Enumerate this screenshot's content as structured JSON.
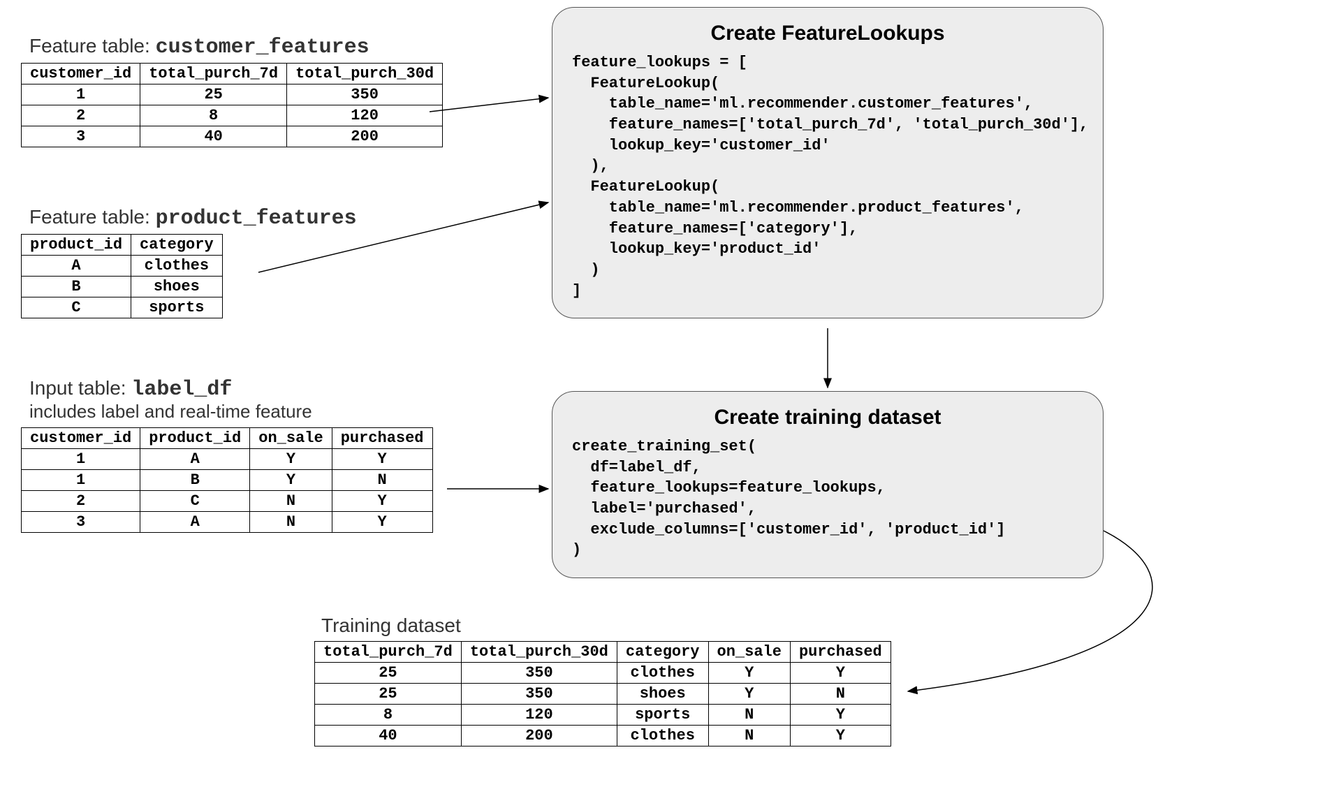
{
  "customer_features": {
    "caption_prefix": "Feature table: ",
    "caption_mono": "customer_features",
    "headers": [
      "customer_id",
      "total_purch_7d",
      "total_purch_30d"
    ],
    "rows": [
      [
        "1",
        "25",
        "350"
      ],
      [
        "2",
        "8",
        "120"
      ],
      [
        "3",
        "40",
        "200"
      ]
    ]
  },
  "product_features": {
    "caption_prefix": "Feature table: ",
    "caption_mono": "product_features",
    "headers": [
      "product_id",
      "category"
    ],
    "rows": [
      [
        "A",
        "clothes"
      ],
      [
        "B",
        "shoes"
      ],
      [
        "C",
        "sports"
      ]
    ]
  },
  "label_df": {
    "caption_prefix": "Input table: ",
    "caption_mono": "label_df",
    "subcaption": "includes label and real-time feature",
    "headers": [
      "customer_id",
      "product_id",
      "on_sale",
      "purchased"
    ],
    "rows": [
      [
        "1",
        "A",
        "Y",
        "Y"
      ],
      [
        "1",
        "B",
        "Y",
        "N"
      ],
      [
        "2",
        "C",
        "N",
        "Y"
      ],
      [
        "3",
        "A",
        "N",
        "Y"
      ]
    ]
  },
  "training_dataset": {
    "caption": "Training dataset",
    "headers": [
      "total_purch_7d",
      "total_purch_30d",
      "category",
      "on_sale",
      "purchased"
    ],
    "rows": [
      [
        "25",
        "350",
        "clothes",
        "Y",
        "Y"
      ],
      [
        "25",
        "350",
        "shoes",
        "Y",
        "N"
      ],
      [
        "8",
        "120",
        "sports",
        "N",
        "Y"
      ],
      [
        "40",
        "200",
        "clothes",
        "N",
        "Y"
      ]
    ]
  },
  "codebox1": {
    "title": "Create FeatureLookups",
    "code": "feature_lookups = [\n  FeatureLookup(\n    table_name='ml.recommender.customer_features',\n    feature_names=['total_purch_7d', 'total_purch_30d'],\n    lookup_key='customer_id'\n  ),\n  FeatureLookup(\n    table_name='ml.recommender.product_features',\n    feature_names=['category'],\n    lookup_key='product_id'\n  )\n]"
  },
  "codebox2": {
    "title": "Create training dataset",
    "code": "create_training_set(\n  df=label_df,\n  feature_lookups=feature_lookups,\n  label='purchased',\n  exclude_columns=['customer_id', 'product_id']\n)"
  }
}
